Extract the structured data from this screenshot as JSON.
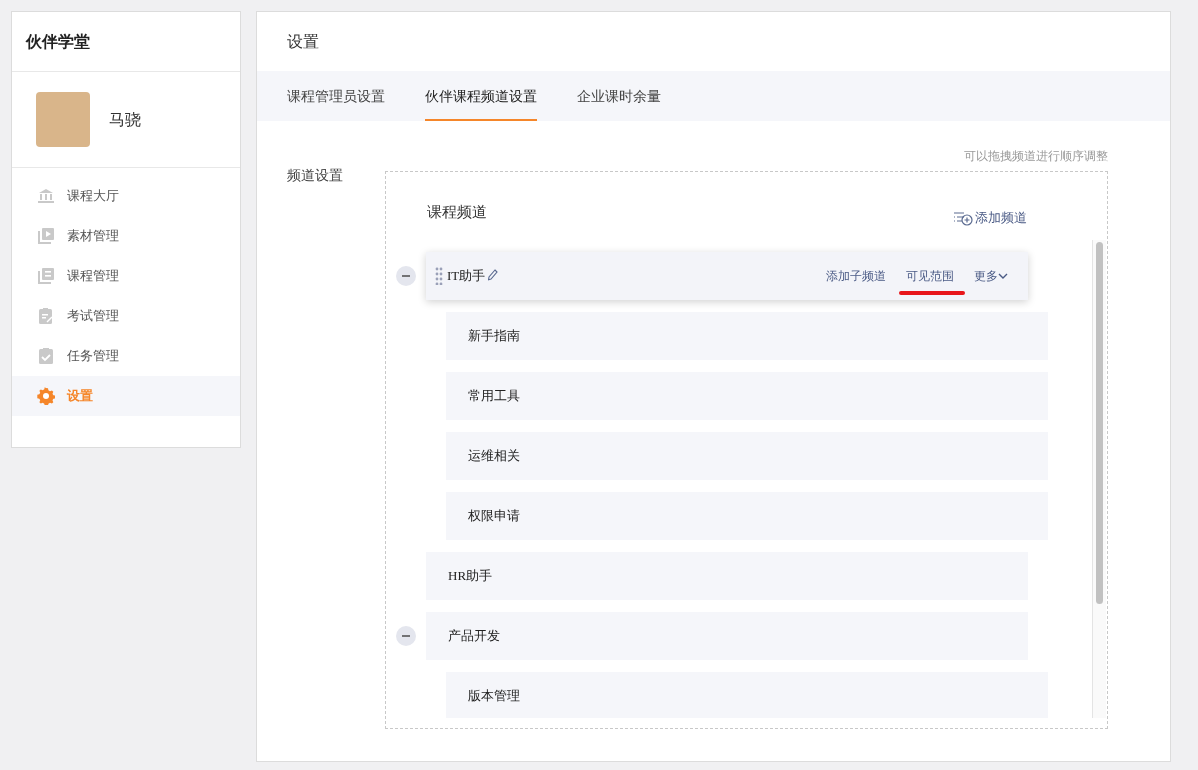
{
  "sidebar": {
    "title": "伙伴学堂",
    "user": {
      "name": "马骁"
    },
    "items": [
      {
        "label": "课程大厅",
        "kind": "bank",
        "selected": false
      },
      {
        "label": "素材管理",
        "kind": "media",
        "selected": false
      },
      {
        "label": "课程管理",
        "kind": "course",
        "selected": false
      },
      {
        "label": "考试管理",
        "kind": "exam",
        "selected": false
      },
      {
        "label": "任务管理",
        "kind": "task",
        "selected": false
      },
      {
        "label": "设置",
        "kind": "gear",
        "selected": true
      }
    ]
  },
  "page": {
    "title": "设置",
    "tabs": [
      {
        "label": "课程管理员设置",
        "selected": false
      },
      {
        "label": "伙伴课程频道设置",
        "selected": true
      },
      {
        "label": "企业课时余量",
        "selected": false
      }
    ],
    "section_label": "频道设置",
    "hint": "可以拖拽频道进行顺序调整",
    "channels": {
      "title": "课程频道",
      "add_button": "添加频道",
      "tree": [
        {
          "name": "IT助手",
          "expanded": true,
          "active": true,
          "actions": [
            {
              "label": "添加子频道",
              "highlighted": false
            },
            {
              "label": "可见范围",
              "highlighted": true
            },
            {
              "label": "更多",
              "highlighted": false
            }
          ],
          "children": [
            {
              "name": "新手指南"
            },
            {
              "name": "常用工具"
            },
            {
              "name": "运维相关"
            },
            {
              "name": "权限申请"
            }
          ]
        },
        {
          "name": "HR助手"
        },
        {
          "name": "产品开发",
          "expanded": true,
          "children": [
            {
              "name": "版本管理"
            }
          ]
        }
      ]
    }
  }
}
